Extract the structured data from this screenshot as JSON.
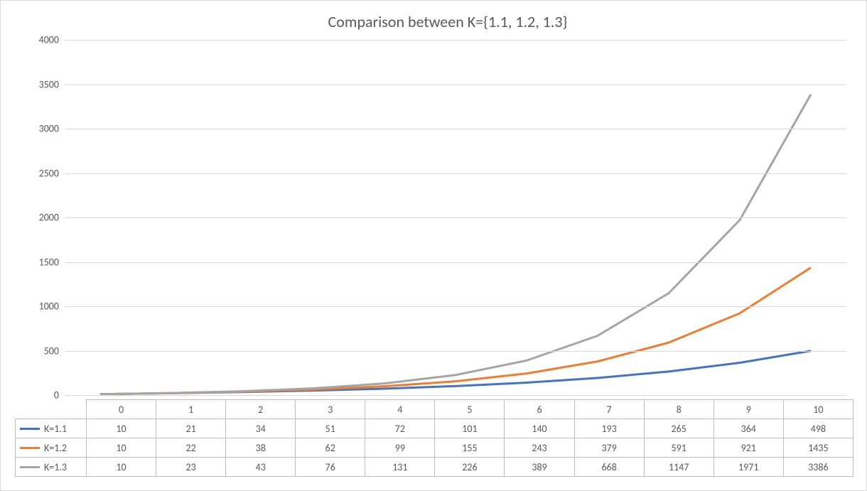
{
  "chart_data": {
    "type": "line",
    "title": "Comparison between K={1.1, 1.2, 1.3}",
    "xlabel": "",
    "ylabel": "",
    "ylim": [
      0,
      4000
    ],
    "y_ticks": [
      0,
      500,
      1000,
      1500,
      2000,
      2500,
      3000,
      3500,
      4000
    ],
    "categories": [
      "0",
      "1",
      "2",
      "3",
      "4",
      "5",
      "6",
      "7",
      "8",
      "9",
      "10"
    ],
    "series": [
      {
        "name": "K=1.1",
        "color": "#4472C4",
        "values": [
          10,
          21,
          34,
          51,
          72,
          101,
          140,
          193,
          265,
          364,
          498
        ]
      },
      {
        "name": "K=1.2",
        "color": "#ED7D31",
        "values": [
          10,
          22,
          38,
          62,
          99,
          155,
          243,
          379,
          591,
          921,
          1435
        ]
      },
      {
        "name": "K=1.3",
        "color": "#A5A5A5",
        "values": [
          10,
          23,
          43,
          76,
          131,
          226,
          389,
          668,
          1147,
          1971,
          3386
        ]
      }
    ]
  }
}
